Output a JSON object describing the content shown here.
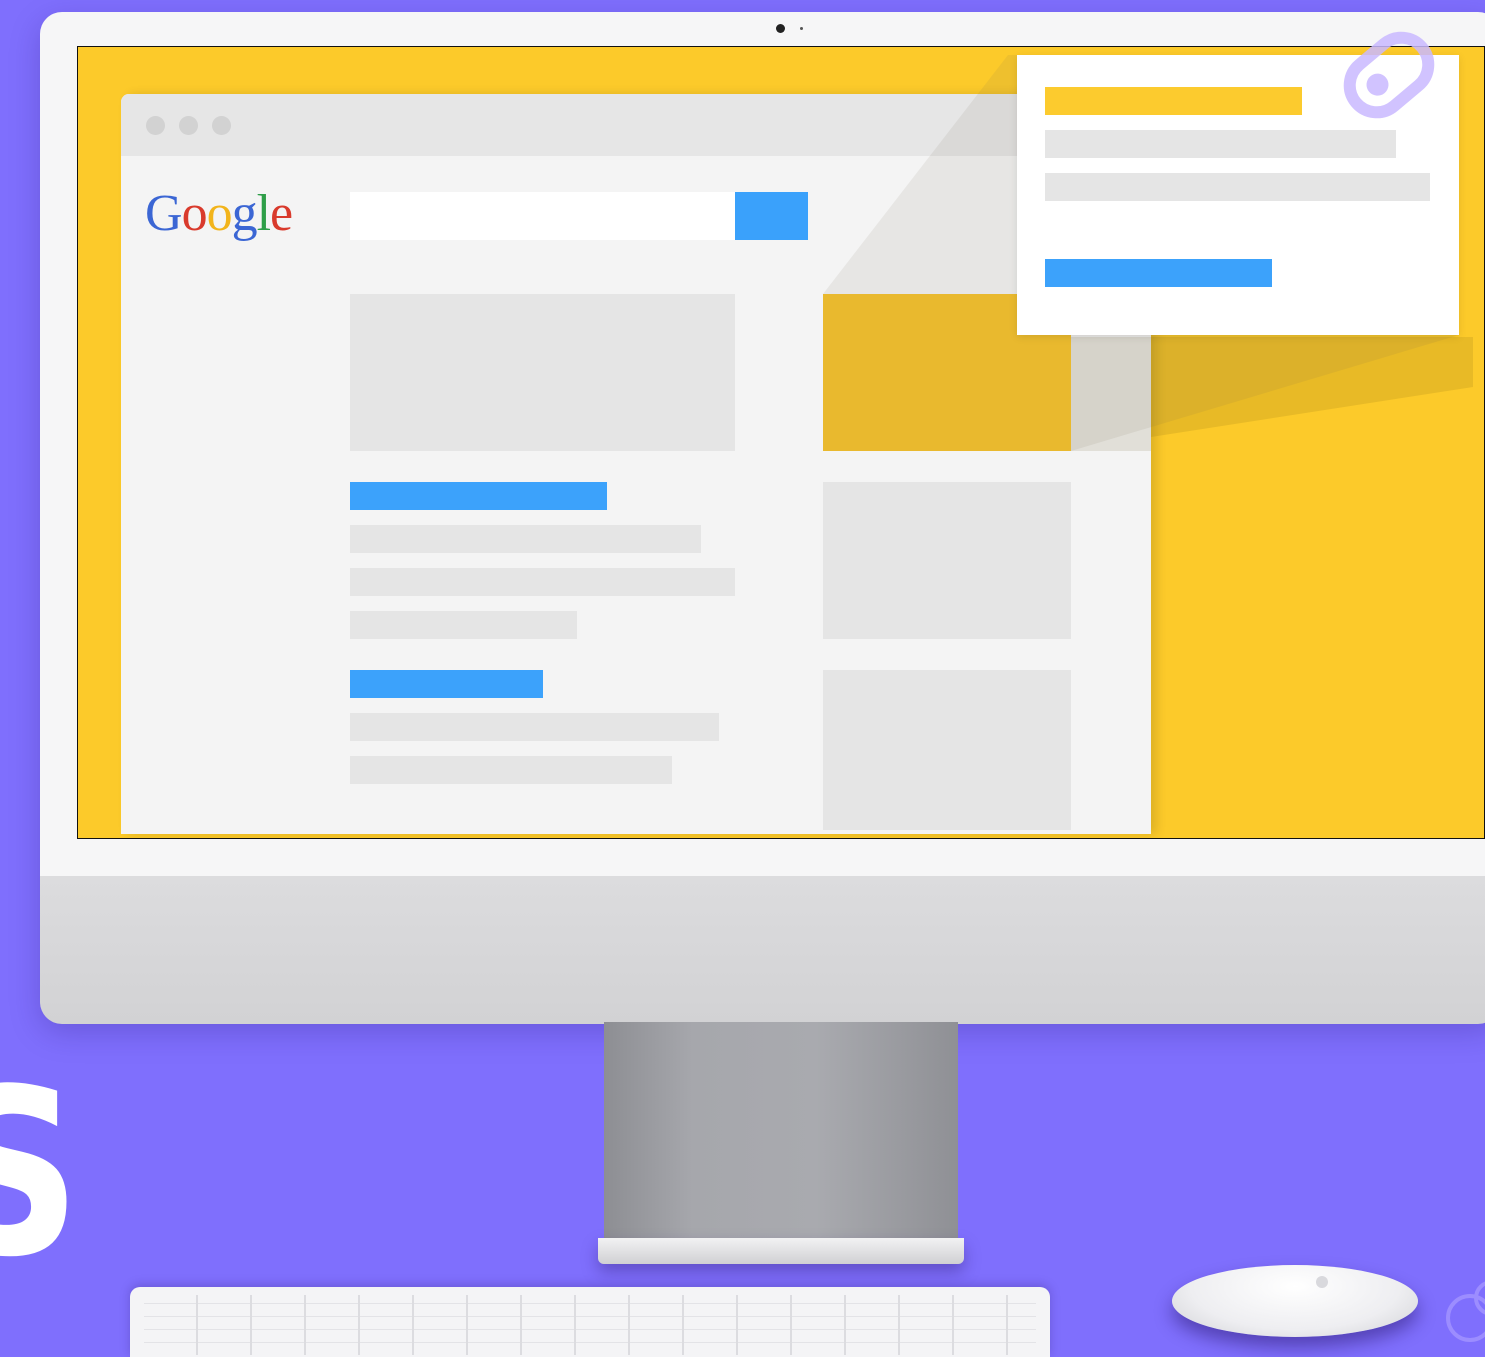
{
  "screen": {
    "browser": {
      "logo": {
        "letters": [
          "G",
          "o",
          "o",
          "g",
          "l",
          "e"
        ],
        "colors": [
          "#3b66d4",
          "#d93a2c",
          "#f2b41b",
          "#3b66d4",
          "#2e9e48",
          "#d93a2c"
        ]
      },
      "search": {
        "value": "",
        "placeholder": ""
      }
    }
  },
  "decor": {
    "cut_letter": "S"
  },
  "colors": {
    "background": "#7f6ffd",
    "screen_yellow": "#fcca2a",
    "accent_blue": "#3ca2fb",
    "placeholder_gray": "#e5e5e5"
  }
}
